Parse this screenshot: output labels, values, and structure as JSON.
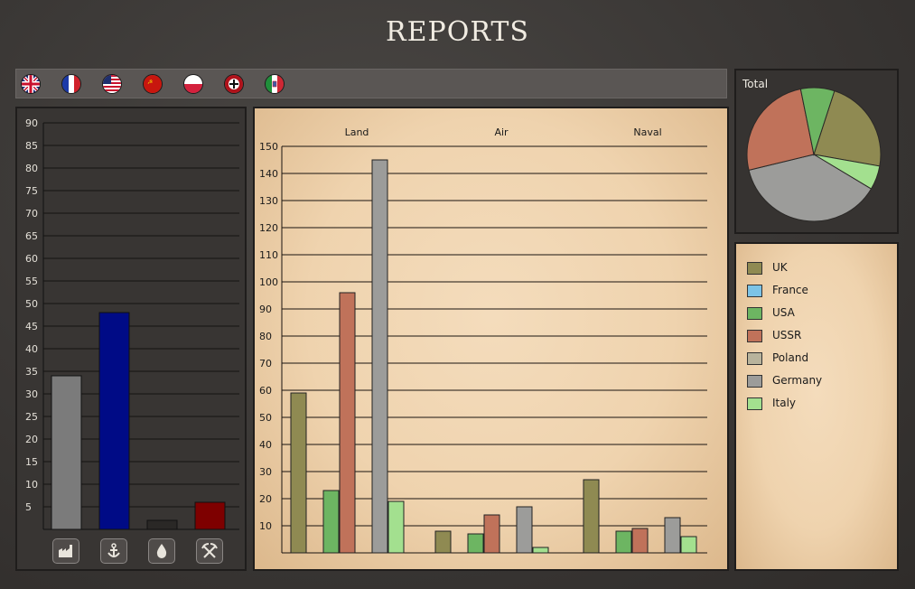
{
  "page": {
    "title": "REPORTS"
  },
  "flags": [
    {
      "country": "UK",
      "icon": "uk-flag-icon"
    },
    {
      "country": "France",
      "icon": "france-flag-icon"
    },
    {
      "country": "USA",
      "icon": "usa-flag-icon"
    },
    {
      "country": "USSR",
      "icon": "ussr-flag-icon"
    },
    {
      "country": "Poland",
      "icon": "poland-flag-icon"
    },
    {
      "country": "Germany",
      "icon": "germany-flag-icon"
    },
    {
      "country": "Italy",
      "icon": "italy-flag-icon"
    }
  ],
  "resources": {
    "buttons": [
      {
        "name": "factory-icon",
        "glyph": "▟"
      },
      {
        "name": "anchor-icon",
        "glyph": "⚓"
      },
      {
        "name": "oil-drop-icon",
        "glyph": "💧"
      },
      {
        "name": "pickaxes-icon",
        "glyph": "⚒"
      }
    ]
  },
  "total": {
    "label": "Total"
  },
  "legend": [
    {
      "name": "UK",
      "color": "#8f8a52"
    },
    {
      "name": "France",
      "color": "#7cc3e6"
    },
    {
      "name": "USA",
      "color": "#6db562"
    },
    {
      "name": "USSR",
      "color": "#c0725a"
    },
    {
      "name": "Poland",
      "color": "#b8b39c"
    },
    {
      "name": "Germany",
      "color": "#9c9c9a"
    },
    {
      "name": "Italy",
      "color": "#a3e08f"
    }
  ],
  "chart_data": [
    {
      "type": "bar",
      "categories": [
        "",
        "",
        "",
        ""
      ],
      "values": [
        34,
        48,
        2,
        6
      ],
      "colors": [
        "#7b7b7b",
        "#000b86",
        "#2a2826",
        "#7e0000"
      ],
      "ylim": [
        0,
        90
      ],
      "yticks": [
        5,
        10,
        15,
        20,
        25,
        30,
        35,
        40,
        45,
        50,
        55,
        60,
        65,
        70,
        75,
        80,
        85,
        90
      ]
    },
    {
      "type": "bar",
      "categories": [
        "Land",
        "Air",
        "Naval"
      ],
      "series": [
        {
          "name": "UK",
          "values": [
            59,
            8,
            27
          ]
        },
        {
          "name": "USA",
          "values": [
            23,
            7,
            8
          ]
        },
        {
          "name": "USSR",
          "values": [
            96,
            14,
            9
          ]
        },
        {
          "name": "Germany",
          "values": [
            145,
            17,
            13
          ]
        },
        {
          "name": "Italy",
          "values": [
            19,
            2,
            6
          ]
        }
      ],
      "ylim": [
        0,
        150
      ],
      "yticks": [
        10,
        20,
        30,
        40,
        50,
        60,
        70,
        80,
        90,
        100,
        110,
        120,
        130,
        140,
        150
      ]
    },
    {
      "type": "pie",
      "title": "Total",
      "slices": [
        {
          "name": "UK",
          "value": 106
        },
        {
          "name": "Italy",
          "value": 27
        },
        {
          "name": "Germany",
          "value": 175
        },
        {
          "name": "USSR",
          "value": 119
        },
        {
          "name": "USA",
          "value": 38
        }
      ]
    }
  ]
}
